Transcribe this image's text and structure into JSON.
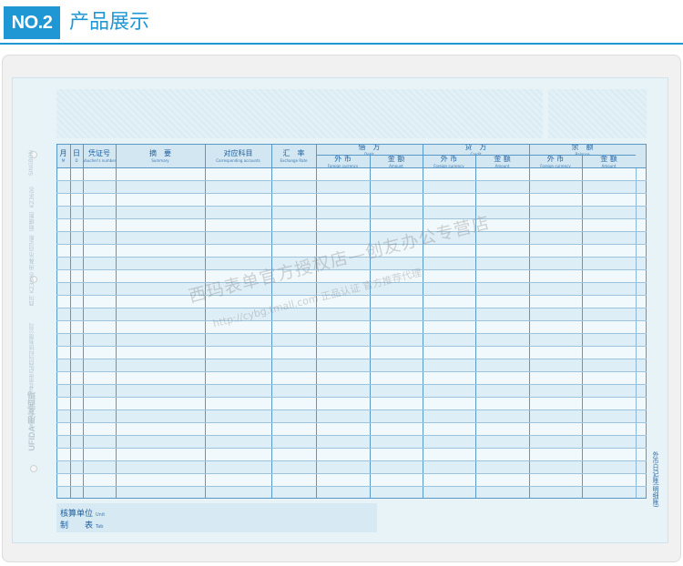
{
  "header": {
    "badge": "NO.2",
    "title": "产品展示"
  },
  "sheet": {
    "side_texts": [
      "SINGBON",
      "外币日记账（明细账）KZ3600",
      "西玛 KZ3600 用友",
      "北京世纪西玛科技有限公司",
      "www.xima.com"
    ],
    "brand": "UFIDA 用友西玛",
    "vertical_label": "外币日记账(明细账)"
  },
  "ledger": {
    "columns": [
      {
        "cn": "月",
        "en": "M"
      },
      {
        "cn": "日",
        "en": "D"
      },
      {
        "cn": "凭证号",
        "en": "Voucher's number"
      },
      {
        "cn": "摘　要",
        "en": "Summary"
      },
      {
        "cn": "对应科目",
        "en": "Corresponding accounts"
      },
      {
        "cn": "汇　率",
        "en": "Exchange Rate"
      }
    ],
    "groups": [
      {
        "cn": "借　方",
        "en": "Debit"
      },
      {
        "cn": "贷　方",
        "en": "Credit"
      },
      {
        "cn": "余　额",
        "en": "Balance"
      }
    ],
    "subcolumns": [
      {
        "cn": "外 币",
        "en": "Foreign currency"
      },
      {
        "cn": "金 额",
        "en": "Amount"
      }
    ],
    "row_count": 26
  },
  "footer": {
    "unit_label": "核算单位",
    "unit_en": "Unit",
    "tab_label": "制　　表",
    "tab_en": "Tab"
  },
  "watermark": {
    "line1": "西玛表单官方授权店—创友办公专营店",
    "line2": "http://cybg.tmall.com 正品认证 官方推荐代理"
  }
}
